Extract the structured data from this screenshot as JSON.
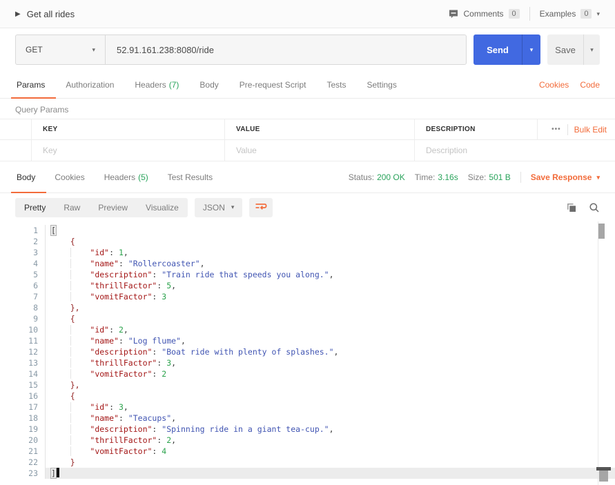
{
  "colors": {
    "accent_orange": "#F26B3A",
    "send_blue": "#4169E1",
    "status_green": "#29A35B",
    "json_key": "#A31515",
    "json_string": "#4054B2",
    "json_number": "#2BA24C"
  },
  "header": {
    "title": "Get all rides",
    "comments": {
      "label": "Comments",
      "count": "0"
    },
    "examples": {
      "label": "Examples",
      "count": "0"
    }
  },
  "request": {
    "method": "GET",
    "url": "52.91.161.238:8080/ride",
    "send": "Send",
    "save": "Save"
  },
  "request_tabs": {
    "params": "Params",
    "authorization": "Authorization",
    "headers": "Headers",
    "headers_count": "(7)",
    "body": "Body",
    "prerequest": "Pre-request Script",
    "tests": "Tests",
    "settings": "Settings",
    "cookies": "Cookies",
    "code": "Code"
  },
  "query_params": {
    "title": "Query Params",
    "col_key": "KEY",
    "col_value": "VALUE",
    "col_description": "DESCRIPTION",
    "more": "•••",
    "bulk_edit": "Bulk Edit",
    "ph_key": "Key",
    "ph_value": "Value",
    "ph_description": "Description"
  },
  "response_meta": {
    "body": "Body",
    "cookies": "Cookies",
    "headers": "Headers",
    "headers_count": "(5)",
    "test_results": "Test Results",
    "status_label": "Status:",
    "status": "200 OK",
    "time_label": "Time:",
    "time": "3.16s",
    "size_label": "Size:",
    "size": "501 B",
    "save_response": "Save Response"
  },
  "response_toolbar": {
    "pretty": "Pretty",
    "raw": "Raw",
    "preview": "Preview",
    "visualize": "Visualize",
    "format": "JSON"
  },
  "response_body": {
    "lines": [
      {
        "n": 1,
        "t": [
          [
            "b",
            "["
          ]
        ]
      },
      {
        "n": 2,
        "t": [
          [
            "",
            "    "
          ],
          [
            "p",
            "{"
          ]
        ]
      },
      {
        "n": 3,
        "t": [
          [
            "",
            "    "
          ],
          [
            "g",
            "    "
          ],
          [
            "k",
            "\"id\""
          ],
          [
            "",
            ": "
          ],
          [
            "u",
            "1"
          ],
          [
            "",
            ","
          ]
        ]
      },
      {
        "n": 4,
        "t": [
          [
            "",
            "    "
          ],
          [
            "g",
            "    "
          ],
          [
            "k",
            "\"name\""
          ],
          [
            "",
            ": "
          ],
          [
            "s",
            "\"Rollercoaster\""
          ],
          [
            "",
            ","
          ]
        ]
      },
      {
        "n": 5,
        "t": [
          [
            "",
            "    "
          ],
          [
            "g",
            "    "
          ],
          [
            "k",
            "\"description\""
          ],
          [
            "",
            ": "
          ],
          [
            "s",
            "\"Train ride that speeds you along.\""
          ],
          [
            "",
            ","
          ]
        ]
      },
      {
        "n": 6,
        "t": [
          [
            "",
            "    "
          ],
          [
            "g",
            "    "
          ],
          [
            "k",
            "\"thrillFactor\""
          ],
          [
            "",
            ": "
          ],
          [
            "u",
            "5"
          ],
          [
            "",
            ","
          ]
        ]
      },
      {
        "n": 7,
        "t": [
          [
            "",
            "    "
          ],
          [
            "g",
            "    "
          ],
          [
            "k",
            "\"vomitFactor\""
          ],
          [
            "",
            ": "
          ],
          [
            "u",
            "3"
          ]
        ]
      },
      {
        "n": 8,
        "t": [
          [
            "",
            "    "
          ],
          [
            "p",
            "},"
          ]
        ]
      },
      {
        "n": 9,
        "t": [
          [
            "",
            "    "
          ],
          [
            "p",
            "{"
          ]
        ]
      },
      {
        "n": 10,
        "t": [
          [
            "",
            "    "
          ],
          [
            "g",
            "    "
          ],
          [
            "k",
            "\"id\""
          ],
          [
            "",
            ": "
          ],
          [
            "u",
            "2"
          ],
          [
            "",
            ","
          ]
        ]
      },
      {
        "n": 11,
        "t": [
          [
            "",
            "    "
          ],
          [
            "g",
            "    "
          ],
          [
            "k",
            "\"name\""
          ],
          [
            "",
            ": "
          ],
          [
            "s",
            "\"Log flume\""
          ],
          [
            "",
            ","
          ]
        ]
      },
      {
        "n": 12,
        "t": [
          [
            "",
            "    "
          ],
          [
            "g",
            "    "
          ],
          [
            "k",
            "\"description\""
          ],
          [
            "",
            ": "
          ],
          [
            "s",
            "\"Boat ride with plenty of splashes.\""
          ],
          [
            "",
            ","
          ]
        ]
      },
      {
        "n": 13,
        "t": [
          [
            "",
            "    "
          ],
          [
            "g",
            "    "
          ],
          [
            "k",
            "\"thrillFactor\""
          ],
          [
            "",
            ": "
          ],
          [
            "u",
            "3"
          ],
          [
            "",
            ","
          ]
        ]
      },
      {
        "n": 14,
        "t": [
          [
            "",
            "    "
          ],
          [
            "g",
            "    "
          ],
          [
            "k",
            "\"vomitFactor\""
          ],
          [
            "",
            ": "
          ],
          [
            "u",
            "2"
          ]
        ]
      },
      {
        "n": 15,
        "t": [
          [
            "",
            "    "
          ],
          [
            "p",
            "},"
          ]
        ]
      },
      {
        "n": 16,
        "t": [
          [
            "",
            "    "
          ],
          [
            "p",
            "{"
          ]
        ]
      },
      {
        "n": 17,
        "t": [
          [
            "",
            "    "
          ],
          [
            "g",
            "    "
          ],
          [
            "k",
            "\"id\""
          ],
          [
            "",
            ": "
          ],
          [
            "u",
            "3"
          ],
          [
            "",
            ","
          ]
        ]
      },
      {
        "n": 18,
        "t": [
          [
            "",
            "    "
          ],
          [
            "g",
            "    "
          ],
          [
            "k",
            "\"name\""
          ],
          [
            "",
            ": "
          ],
          [
            "s",
            "\"Teacups\""
          ],
          [
            "",
            ","
          ]
        ]
      },
      {
        "n": 19,
        "t": [
          [
            "",
            "    "
          ],
          [
            "g",
            "    "
          ],
          [
            "k",
            "\"description\""
          ],
          [
            "",
            ": "
          ],
          [
            "s",
            "\"Spinning ride in a giant tea-cup.\""
          ],
          [
            "",
            ","
          ]
        ]
      },
      {
        "n": 20,
        "t": [
          [
            "",
            "    "
          ],
          [
            "g",
            "    "
          ],
          [
            "k",
            "\"thrillFactor\""
          ],
          [
            "",
            ": "
          ],
          [
            "u",
            "2"
          ],
          [
            "",
            ","
          ]
        ]
      },
      {
        "n": 21,
        "t": [
          [
            "",
            "    "
          ],
          [
            "g",
            "    "
          ],
          [
            "k",
            "\"vomitFactor\""
          ],
          [
            "",
            ": "
          ],
          [
            "u",
            "4"
          ]
        ]
      },
      {
        "n": 22,
        "t": [
          [
            "",
            "    "
          ],
          [
            "p",
            "}"
          ]
        ]
      },
      {
        "n": 23,
        "active": true,
        "t": [
          [
            "b",
            "]"
          ],
          [
            "c",
            ""
          ]
        ]
      }
    ]
  }
}
